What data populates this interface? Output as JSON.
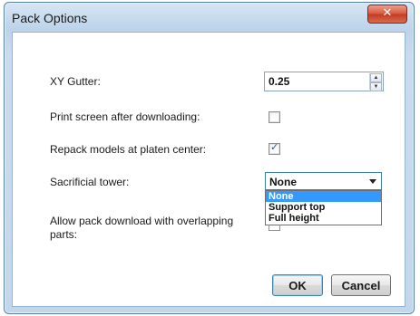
{
  "window": {
    "title": "Pack Options",
    "close_glyph": "✕"
  },
  "fields": {
    "xy_gutter": {
      "label": "XY Gutter:",
      "value": "0.25"
    },
    "print_screen": {
      "label": "Print screen after downloading:",
      "checked": false
    },
    "repack": {
      "label": "Repack models at platen center:",
      "checked": true
    },
    "sacrificial_tower": {
      "label": "Sacrificial tower:",
      "value": "None",
      "options": [
        "None",
        "Support top",
        "Full height"
      ]
    },
    "allow_overlap": {
      "label_line1": "Allow pack download with overlapping",
      "label_line2": "parts:"
    }
  },
  "buttons": {
    "ok": "OK",
    "cancel": "Cancel"
  },
  "icons": {
    "check": "✓",
    "spin_up": "▲",
    "spin_down": "▼"
  }
}
